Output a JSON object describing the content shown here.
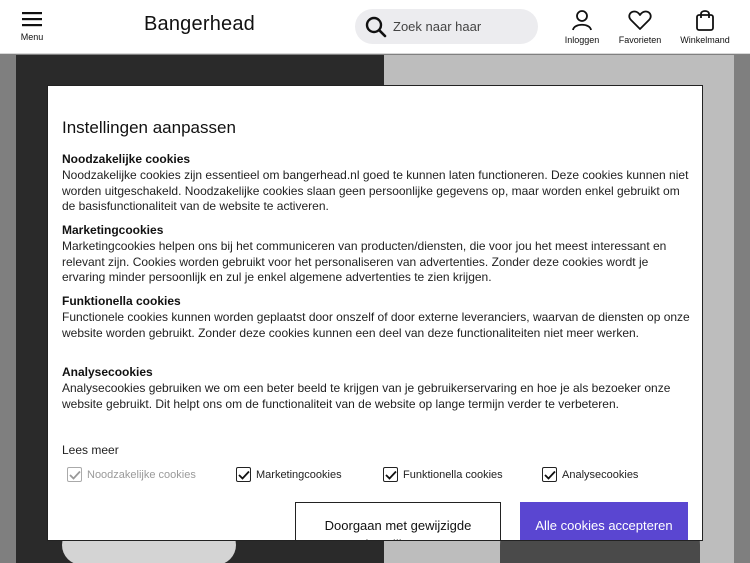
{
  "header": {
    "menu_label": "Menu",
    "logo": "Bangerhead",
    "search_placeholder": "Zoek naar haar",
    "login_label": "Inloggen",
    "favorites_label": "Favorieten",
    "cart_label": "Winkelmand"
  },
  "modal": {
    "title": "Instellingen aanpassen",
    "sections": [
      {
        "heading": "Noodzakelijke cookies",
        "text": "Noodzakelijke cookies zijn essentieel om bangerhead.nl goed te kunnen laten functioneren. Deze cookies kunnen niet worden uitgeschakeld. Noodzakelijke cookies slaan geen persoonlijke gegevens op, maar worden enkel gebruikt om de basisfunctionaliteit van de website te activeren."
      },
      {
        "heading": "Marketingcookies",
        "text": "Marketingcookies helpen ons bij het communiceren van producten/diensten, die voor jou het meest interessant en relevant zijn. Cookies worden gebruikt voor het personaliseren van advertenties. Zonder deze cookies wordt je ervaring minder persoonlijk en zul je enkel algemene advertenties te zien krijgen."
      },
      {
        "heading": "Funktionella cookies",
        "text": "Functionele cookies kunnen worden geplaatst door onszelf of door externe leveranciers, waarvan de diensten op onze website worden gebruikt. Zonder deze cookies kunnen een deel van deze functionaliteiten niet meer werken."
      },
      {
        "heading": "Analysecookies",
        "text": "Analysecookies gebruiken we om een beter beeld te krijgen van je gebruikerservaring en hoe je als bezoeker onze website gebruikt. Dit helpt ons om de functionaliteit van de website op lange termijn verder te verbeteren."
      }
    ],
    "read_more": "Lees meer",
    "checkboxes": [
      {
        "label": "Noodzakelijke cookies",
        "checked": true,
        "disabled": true
      },
      {
        "label": "Marketingcookies",
        "checked": true,
        "disabled": false
      },
      {
        "label": "Funktionella cookies",
        "checked": true,
        "disabled": false
      },
      {
        "label": "Analysecookies",
        "checked": true,
        "disabled": false
      }
    ],
    "save_button": "Doorgaan met gewijzigde instellingen",
    "accept_button": "Alle cookies accepteren"
  },
  "colors": {
    "accent": "#5a46d1",
    "overlay": "#7f7f7f"
  }
}
